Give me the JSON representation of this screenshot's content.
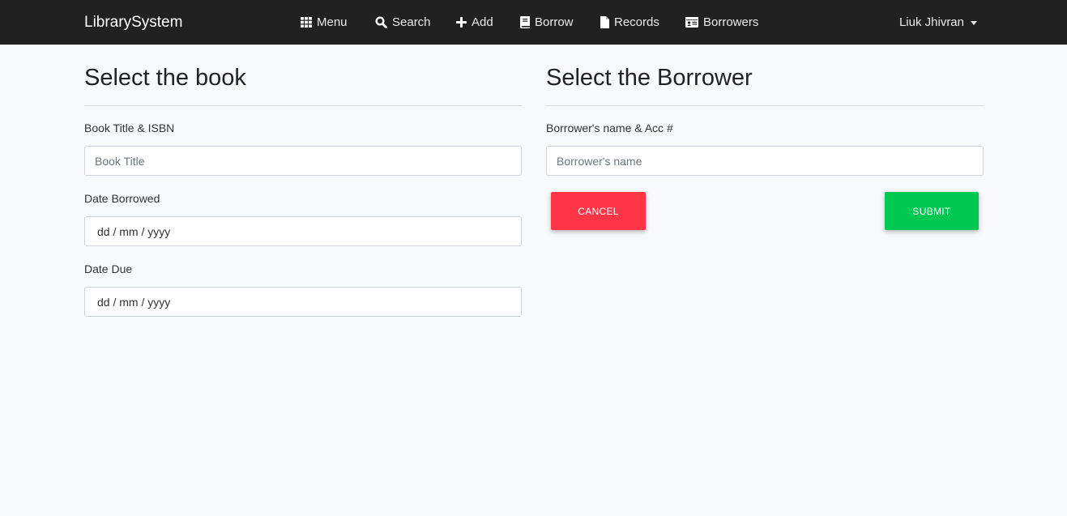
{
  "navbar": {
    "brand": "LibrarySystem",
    "items": [
      {
        "label": "Menu",
        "icon": "grid-icon"
      },
      {
        "label": "Search",
        "icon": "search-icon"
      },
      {
        "label": "Add",
        "icon": "plus-icon"
      },
      {
        "label": "Borrow",
        "icon": "book-icon"
      },
      {
        "label": "Records",
        "icon": "file-icon"
      },
      {
        "label": "Borrowers",
        "icon": "id-card-icon"
      }
    ],
    "user": "Liuk Jhivran"
  },
  "book_section": {
    "title": "Select the book",
    "book_label": "Book Title & ISBN",
    "book_placeholder": "Book Title",
    "date_borrowed_label": "Date Borrowed",
    "date_borrowed_value": "dd / mm / yyyy",
    "date_due_label": "Date Due",
    "date_due_value": "dd / mm / yyyy"
  },
  "borrower_section": {
    "title": "Select the Borrower",
    "borrower_label": "Borrower's name & Acc #",
    "borrower_placeholder": "Borrower's name",
    "cancel_label": "CANCEL",
    "submit_label": "SUBMIT"
  },
  "colors": {
    "navbar": "#212121",
    "background": "#f8f9fb",
    "cancel": "#ff3547",
    "submit": "#00c851"
  }
}
